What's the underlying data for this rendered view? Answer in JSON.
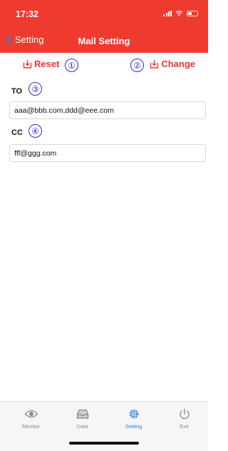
{
  "status_bar": {
    "time": "17:32"
  },
  "nav": {
    "back_label": "Setting",
    "title": "Mail Setting"
  },
  "actions": {
    "reset_label": "Reset",
    "change_label": "Change"
  },
  "markers": {
    "one": "①",
    "two": "②",
    "three": "③",
    "four": "④"
  },
  "fields": {
    "to": {
      "label": "TO",
      "value": "aaa@bbb.com,ddd@eee.com"
    },
    "cc": {
      "label": "CC",
      "value": "fff@ggg.com"
    }
  },
  "tabs": [
    {
      "label": "Monitor",
      "icon": "eye-icon"
    },
    {
      "label": "Data",
      "icon": "inbox-icon"
    },
    {
      "label": "Setting",
      "icon": "gear-icon",
      "active": true
    },
    {
      "label": "Exit",
      "icon": "power-icon"
    }
  ],
  "colors": {
    "accent": "#ee3a2f",
    "marker": "#2a2ad0",
    "active_tab": "#2f7de1",
    "inactive_tab": "#8a8a8a"
  }
}
